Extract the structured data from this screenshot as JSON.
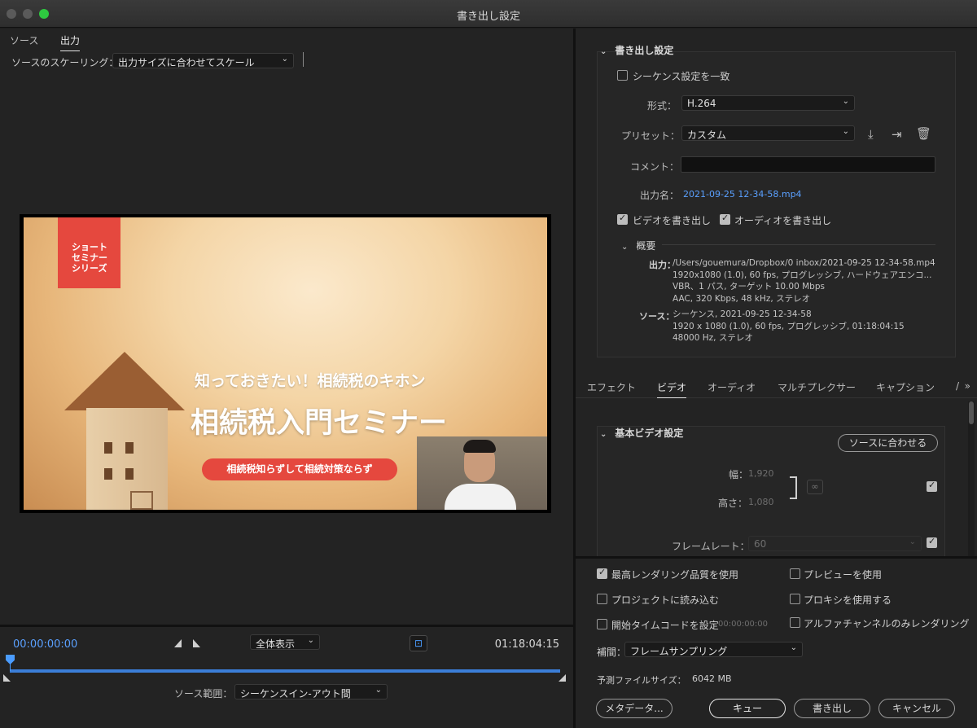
{
  "window": {
    "title": "書き出し設定"
  },
  "left": {
    "tabs": [
      {
        "label": "ソース"
      },
      {
        "label": "出力"
      }
    ],
    "scaling": {
      "label": "ソースのスケーリング：",
      "value": "出力サイズに合わせてスケール"
    },
    "preview": {
      "badge_lines": [
        "ショート",
        "セミナー",
        "シリーズ"
      ],
      "subtitle": "知っておきたい！相続税のキホン",
      "title": "相続税入門セミナー",
      "pill": "相続税知らずして相続対策ならず"
    },
    "timeline": {
      "current_tc": "00:00:00:00",
      "end_tc": "01:18:04:15",
      "zoom": "全体表示",
      "range_label": "ソース範囲：",
      "range_value": "シーケンスイン-アウト間",
      "playhead_position": 0
    }
  },
  "right": {
    "export_settings": {
      "header": "書き出し設定",
      "match_sequence": {
        "label": "シーケンス設定を一致",
        "checked": false
      },
      "format_label": "形式：",
      "format_value": "H.264",
      "preset_label": "プリセット：",
      "preset_value": "カスタム",
      "comment_label": "コメント：",
      "comment_value": "",
      "output_name_label": "出力名：",
      "output_name_value": "2021-09-25 12-34-58.mp4",
      "export_video": {
        "label": "ビデオを書き出し",
        "checked": true
      },
      "export_audio": {
        "label": "オーディオを書き出し",
        "checked": true
      },
      "summary": {
        "header": "概要",
        "output_key": "出力：",
        "output_lines": [
          "/Users/gouemura/Dropbox/0 inbox/2021-09-25 12-34-58.mp4",
          "1920x1080 (1.0), 60 fps, プログレッシブ, ハードウェアエンコ...",
          "VBR、1 パス, ターゲット 10.00 Mbps",
          "AAC, 320 Kbps, 48 kHz, ステレオ"
        ],
        "source_key": "ソース：",
        "source_lines": [
          "シーケンス, 2021-09-25 12-34-58",
          "1920 x 1080 (1.0), 60 fps, プログレッシブ, 01:18:04:15",
          "48000 Hz, ステレオ"
        ]
      }
    },
    "tabs": [
      {
        "label": "エフェクト"
      },
      {
        "label": "ビデオ"
      },
      {
        "label": "オーディオ"
      },
      {
        "label": "マルチプレクサー"
      },
      {
        "label": "キャプション"
      },
      {
        "label": "/"
      }
    ],
    "video": {
      "header": "基本ビデオ設定",
      "match_source_btn": "ソースに合わせる",
      "width_label": "幅：",
      "width_value": "1,920",
      "height_label": "高さ：",
      "height_value": "1,080",
      "framerate_label": "フレームレート：",
      "framerate_value": "60"
    },
    "options": {
      "max_render_quality": {
        "label": "最高レンダリング品質を使用",
        "checked": true
      },
      "use_previews": {
        "label": "プレビューを使用",
        "checked": false
      },
      "import_into_project": {
        "label": "プロジェクトに読み込む",
        "checked": false
      },
      "use_proxies": {
        "label": "プロキシを使用する",
        "checked": false
      },
      "set_start_tc": {
        "label": "開始タイムコードを設定",
        "checked": false,
        "value": "00:00:00:00"
      },
      "alpha_only": {
        "label": "アルファチャンネルのみレンダリング",
        "checked": false
      },
      "interpolation_label": "補間：",
      "interpolation_value": "フレームサンプリング",
      "est_size_label": "予測ファイルサイズ：",
      "est_size_value": "6042 MB"
    },
    "buttons": {
      "metadata": "メタデータ...",
      "queue": "キュー",
      "export": "書き出し",
      "cancel": "キャンセル"
    }
  }
}
